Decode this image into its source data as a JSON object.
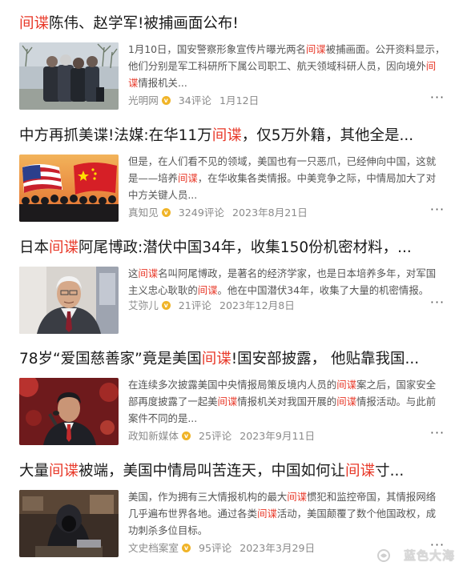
{
  "articles": [
    {
      "title_parts": [
        {
          "text": "间谍",
          "hl": true
        },
        {
          "text": "陈伟、赵学军!被捕画面公布!",
          "hl": false
        }
      ],
      "summary_parts": [
        {
          "text": "1月10日，国安警察形象宣传片曝光两名",
          "hl": false
        },
        {
          "text": "间谍",
          "hl": true
        },
        {
          "text": "被捕画面。公开资料显示，他们分别是军工科研所下属公司职工、航天领域科研人员，因向境外",
          "hl": false
        },
        {
          "text": "间谍",
          "hl": true
        },
        {
          "text": "情报机关...",
          "hl": false
        }
      ],
      "source": "光明网",
      "comments": "34评论",
      "date": "1月12日",
      "thumb_icon": "arrest-photo"
    },
    {
      "title_parts": [
        {
          "text": "中方再抓美谍!法媒:在华11万",
          "hl": false
        },
        {
          "text": "间谍",
          "hl": true
        },
        {
          "text": "，仅5万外籍，其他全是...",
          "hl": false
        }
      ],
      "summary_parts": [
        {
          "text": "但是，在人们看不见的领域，美国也有一只恶爪，已经伸向中国，这就是——培养",
          "hl": false
        },
        {
          "text": "间谍",
          "hl": true
        },
        {
          "text": "，在华收集各类情报。中美竞争之际，中情局加大了对中方关键人员...",
          "hl": false
        }
      ],
      "source": "真知见",
      "comments": "3249评论",
      "date": "2023年8月21日",
      "thumb_icon": "flags-photo"
    },
    {
      "title_parts": [
        {
          "text": "日本",
          "hl": false
        },
        {
          "text": "间谍",
          "hl": true
        },
        {
          "text": "阿尾博政:潜伏中国34年，收集150份机密材料，...",
          "hl": false
        }
      ],
      "summary_parts": [
        {
          "text": "这",
          "hl": false
        },
        {
          "text": "间谍",
          "hl": true
        },
        {
          "text": "名叫阿尾博政，是著名的经济学家，也是日本培养多年，对军国主义忠心耿耿的",
          "hl": false
        },
        {
          "text": "间谍",
          "hl": true
        },
        {
          "text": "。他在中国潜伏34年，收集了大量的机密情报。",
          "hl": false
        }
      ],
      "source": "艾弥儿",
      "comments": "21评论",
      "date": "2023年12月8日",
      "thumb_icon": "portrait-photo"
    },
    {
      "title_parts": [
        {
          "text": "78岁“爱国慈善家”竟是美国",
          "hl": false
        },
        {
          "text": "间谍",
          "hl": true
        },
        {
          "text": "!国安部披露，  他贴靠我国...",
          "hl": false
        }
      ],
      "summary_parts": [
        {
          "text": "在连续多次披露美国中央情报局策反境内人员的",
          "hl": false
        },
        {
          "text": "间谍",
          "hl": true
        },
        {
          "text": "案之后，国家安全部再度披露了一起美",
          "hl": false
        },
        {
          "text": "间谍",
          "hl": true
        },
        {
          "text": "情报机关对我国开展的",
          "hl": false
        },
        {
          "text": "间谍",
          "hl": true
        },
        {
          "text": "情报活动。与此前案件不同的是...",
          "hl": false
        }
      ],
      "source": "政知新媒体",
      "comments": "25评论",
      "date": "2023年9月11日",
      "thumb_icon": "speaker-photo"
    },
    {
      "title_parts": [
        {
          "text": "大量",
          "hl": false
        },
        {
          "text": "间谍",
          "hl": true
        },
        {
          "text": "被端，美国中情局叫苦连天，中国如何让",
          "hl": false
        },
        {
          "text": "间谍",
          "hl": true
        },
        {
          "text": "寸...",
          "hl": false
        }
      ],
      "summary_parts": [
        {
          "text": "美国，作为拥有三大情报机构的最大",
          "hl": false
        },
        {
          "text": "间谍",
          "hl": true
        },
        {
          "text": "惯犯和监控帝国，其情报网络几乎遍布世界各地。通过各类",
          "hl": false
        },
        {
          "text": "间谍",
          "hl": true
        },
        {
          "text": "活动，美国颠覆了数个他国政权，成功刺杀多位目标。",
          "hl": false
        }
      ],
      "source": "文史档案室",
      "comments": "95评论",
      "date": "2023年3月29日",
      "thumb_icon": "hooded-figure-photo"
    }
  ],
  "verified_badge": "v",
  "more_glyph": "···",
  "watermark": "蓝色大海",
  "colors": {
    "highlight": "#e83828",
    "meta": "#8a8a8a",
    "badge": "#f0b428"
  }
}
